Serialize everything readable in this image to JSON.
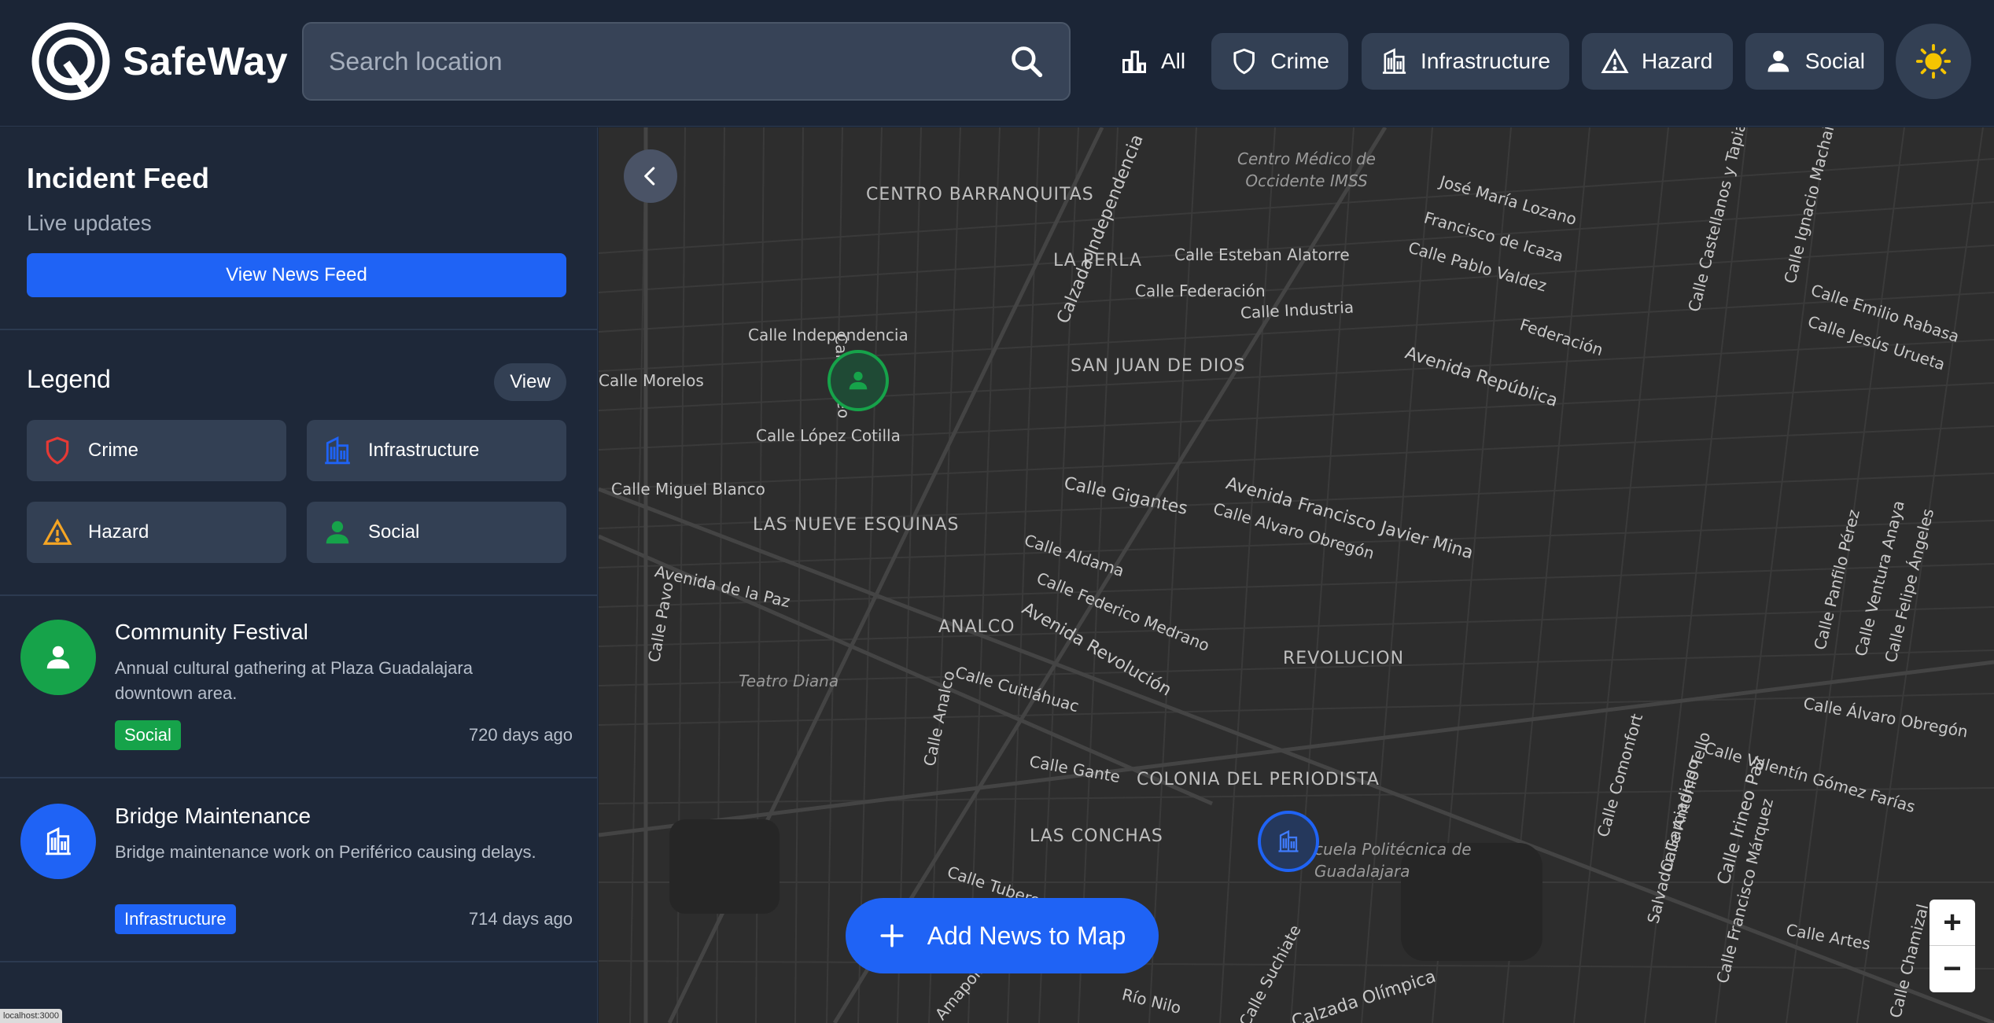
{
  "app": {
    "name": "SafeWay"
  },
  "search": {
    "placeholder": "Search location"
  },
  "filters": [
    {
      "label": "All",
      "icon": "bar-chart-icon"
    },
    {
      "label": "Crime",
      "icon": "shield-icon"
    },
    {
      "label": "Infrastructure",
      "icon": "building-icon"
    },
    {
      "label": "Hazard",
      "icon": "warning-icon"
    },
    {
      "label": "Social",
      "icon": "person-icon"
    }
  ],
  "sidebar": {
    "feed_title": "Incident Feed",
    "feed_subtitle": "Live updates",
    "view_news_label": "View News Feed",
    "legend_title": "Legend",
    "legend_view_label": "View",
    "legend": [
      {
        "label": "Crime",
        "icon": "shield-icon",
        "color": "#e53935"
      },
      {
        "label": "Infrastructure",
        "icon": "building-icon",
        "color": "#1f63f5"
      },
      {
        "label": "Hazard",
        "icon": "warning-icon",
        "color": "#f5a524"
      },
      {
        "label": "Social",
        "icon": "person-icon",
        "color": "#16a34a"
      }
    ],
    "incidents": [
      {
        "title": "Community Festival",
        "description": "Annual cultural gathering at Plaza Guadalajara downtown area.",
        "category": "Social",
        "time": "720 days ago",
        "color": "#16a34a"
      },
      {
        "title": "Bridge Maintenance",
        "description": "Bridge maintenance work on Periférico causing delays.",
        "category": "Infrastructure",
        "time": "714 days ago",
        "color": "#1f63f5"
      }
    ]
  },
  "status_url": "localhost:3000",
  "map": {
    "add_news_label": "Add News to Map",
    "zoom_in": "+",
    "zoom_out": "−",
    "districts": [
      "CENTRO BARRANQUITAS",
      "LA PERLA",
      "SAN JUAN DE DIOS",
      "LAS NUEVE ESQUINAS",
      "ANALCO",
      "REVOLUCION",
      "COLONIA DEL PERIODISTA",
      "LAS CONCHAS"
    ],
    "streets": [
      "Calle Independencia",
      "Calle Morelos",
      "Calle López Cotilla",
      "Calle Miguel Blanco",
      "Avenida de la Paz",
      "Calle Pavo",
      "Calle Liceo",
      "Calle Esteban Alatorre",
      "Calle Federación",
      "Calle Industria",
      "Calle Gigantes",
      "Avenida Francisco Javier Mina",
      "Calle Alvaro Obregón",
      "Calle Aldama",
      "Calle Federico Medrano",
      "Avenida Revolución",
      "Calle Cuitláhuac",
      "Calle Analco",
      "Calle Gante",
      "Calle Tuberos",
      "Calle Pablo Valdez",
      "Avenida República",
      "Francisco de Icaza",
      "José María Lozano",
      "Federación",
      "Calle Emilio Rabasa",
      "Calle Jesús Urueta",
      "Calle Comonfort",
      "Calle Antonio Tello",
      "Calle Irineo Paz",
      "Calle Valentín Gómez Farías",
      "Calle Álvaro Obregón",
      "Calle Artes",
      "Calzada Olímpica",
      "Río Nilo",
      "Calzada Independencia",
      "Calle Castellanos y Tapia",
      "Calle Ignacio Machain",
      "Calle Panfilo Pérez",
      "Calle Ventura Anaya",
      "Calle Felipe Ángeles",
      "Salvador Garciadiego",
      "Calle Francisco Márquez",
      "Calle Chamizal",
      "Calle Suchiate",
      "Amapola"
    ],
    "places": [
      "Centro Médico de Occidente IMSS",
      "Teatro Diana",
      "cuela Politécnica de Guadalajara"
    ]
  }
}
